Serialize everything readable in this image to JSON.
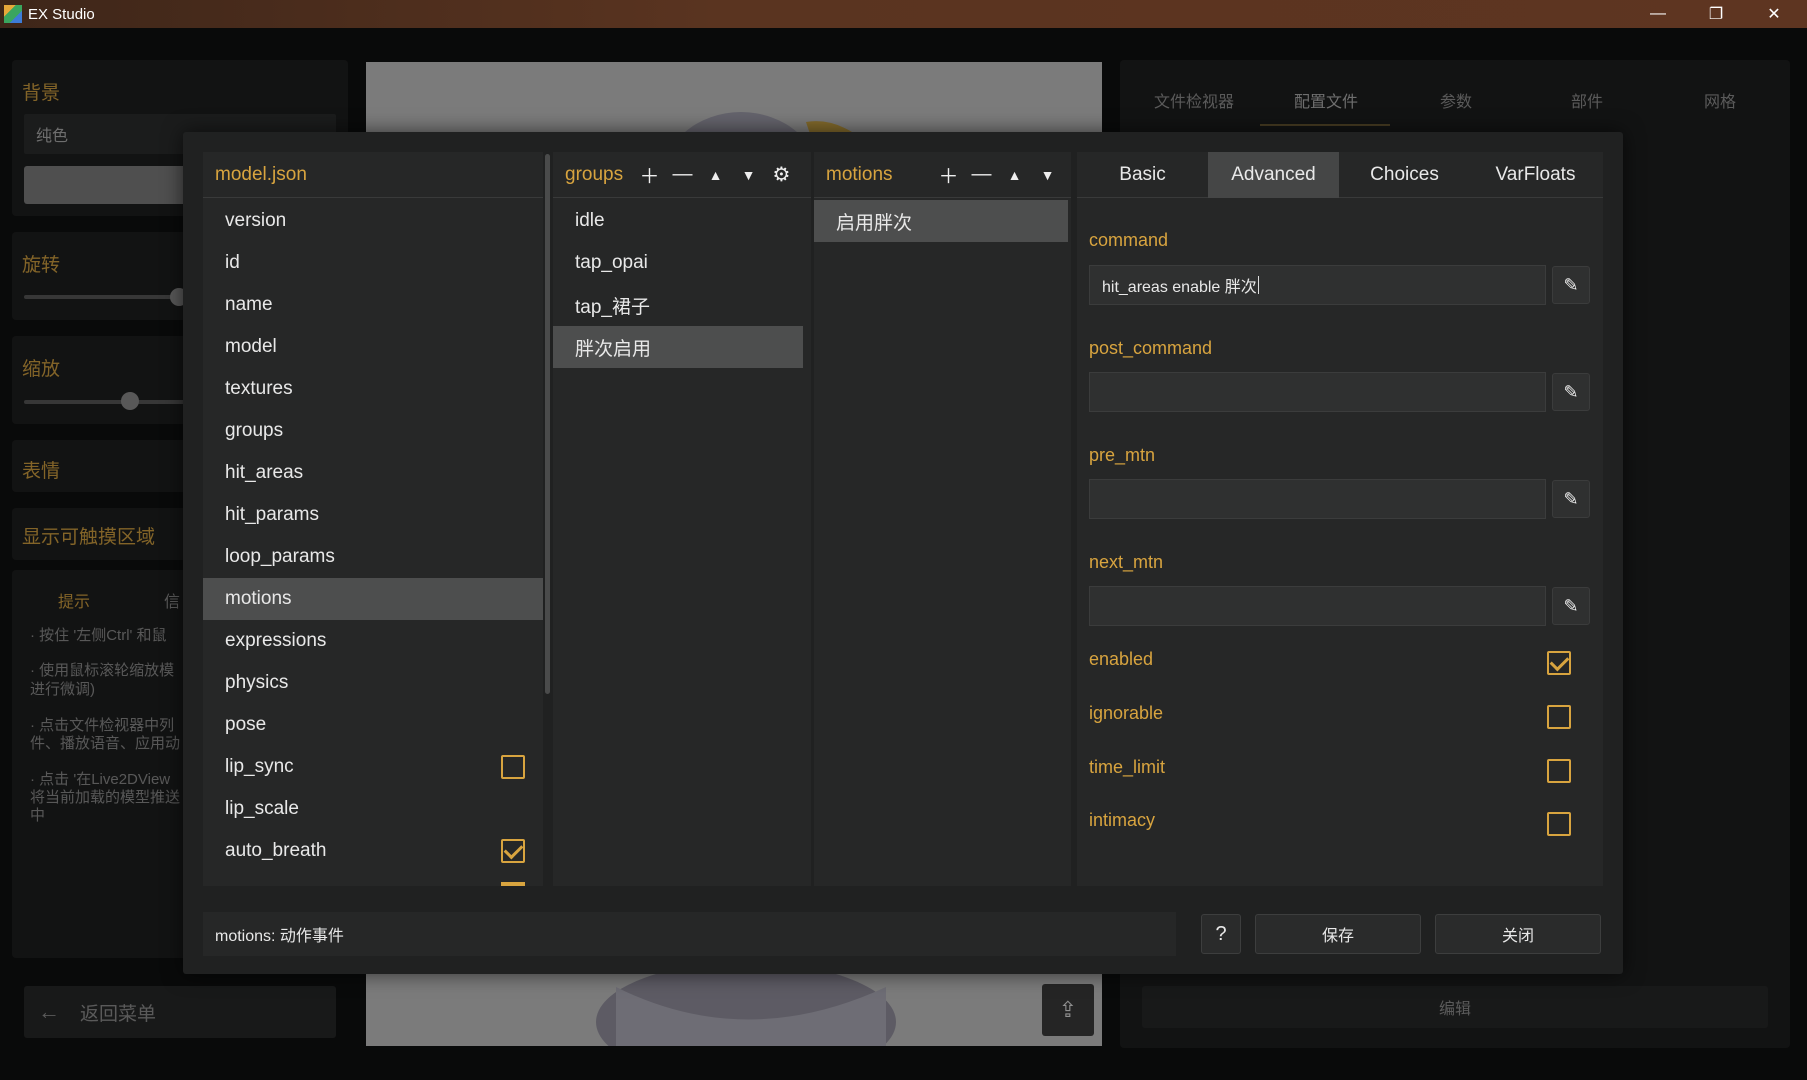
{
  "window": {
    "title": "EX Studio",
    "minimize": "—",
    "maximize": "❐",
    "close": "✕"
  },
  "background": {
    "sidebar": {
      "bg_label": "背景",
      "bg_select": "纯色",
      "rotate_label": "旋转",
      "scale_label": "缩放",
      "expression_label": "表情",
      "hit_area_label": "显示可触摸区域",
      "tip_tab": "提示",
      "info_tab": "信",
      "tips": [
        "· 按住 '左侧Ctrl' 和鼠",
        "· 使用鼠标滚轮缩放模",
        "进行微调)",
        "· 点击文件检视器中列",
        "件、播放语音、应用动",
        "· 点击 '在Live2DView",
        "将当前加载的模型推送",
        "中"
      ],
      "back_label": "返回菜单"
    },
    "right_tabs": [
      "文件检视器",
      "配置文件",
      "参数",
      "部件",
      "网格"
    ],
    "edit_button": "编辑"
  },
  "modal": {
    "root_panel": {
      "title": "model.json",
      "items": [
        {
          "label": "version"
        },
        {
          "label": "id"
        },
        {
          "label": "name"
        },
        {
          "label": "model"
        },
        {
          "label": "textures"
        },
        {
          "label": "groups"
        },
        {
          "label": "hit_areas"
        },
        {
          "label": "hit_params"
        },
        {
          "label": "loop_params"
        },
        {
          "label": "motions"
        },
        {
          "label": "expressions"
        },
        {
          "label": "physics"
        },
        {
          "label": "pose"
        },
        {
          "label": "lip_sync"
        },
        {
          "label": "lip_scale"
        },
        {
          "label": "auto_breath"
        }
      ],
      "selected": "motions"
    },
    "groups_panel": {
      "title": "groups",
      "items": [
        "idle",
        "tap_opai",
        "tap_裙子",
        "胖次启用"
      ],
      "selected": "胖次启用"
    },
    "motions_panel": {
      "title": "motions",
      "items": [
        "启用胖次"
      ],
      "selected": "启用胖次"
    },
    "detail_panel": {
      "tabs": [
        "Basic",
        "Advanced",
        "Choices",
        "VarFloats"
      ],
      "active_tab": "Advanced",
      "fields": [
        {
          "label": "command",
          "value": "hit_areas enable 胖次"
        },
        {
          "label": "post_command",
          "value": ""
        },
        {
          "label": "pre_mtn",
          "value": ""
        },
        {
          "label": "next_mtn",
          "value": ""
        }
      ],
      "flags": [
        {
          "label": "enabled",
          "checked": true
        },
        {
          "label": "ignorable",
          "checked": false
        },
        {
          "label": "time_limit",
          "checked": false
        },
        {
          "label": "intimacy",
          "checked": false
        }
      ]
    },
    "status_text": "motions: 动作事件",
    "help_label": "?",
    "save_label": "保存",
    "close_label": "关闭"
  },
  "colors": {
    "accent": "#d8a43f",
    "panel": "#262727",
    "selected": "#4d4e4e"
  }
}
